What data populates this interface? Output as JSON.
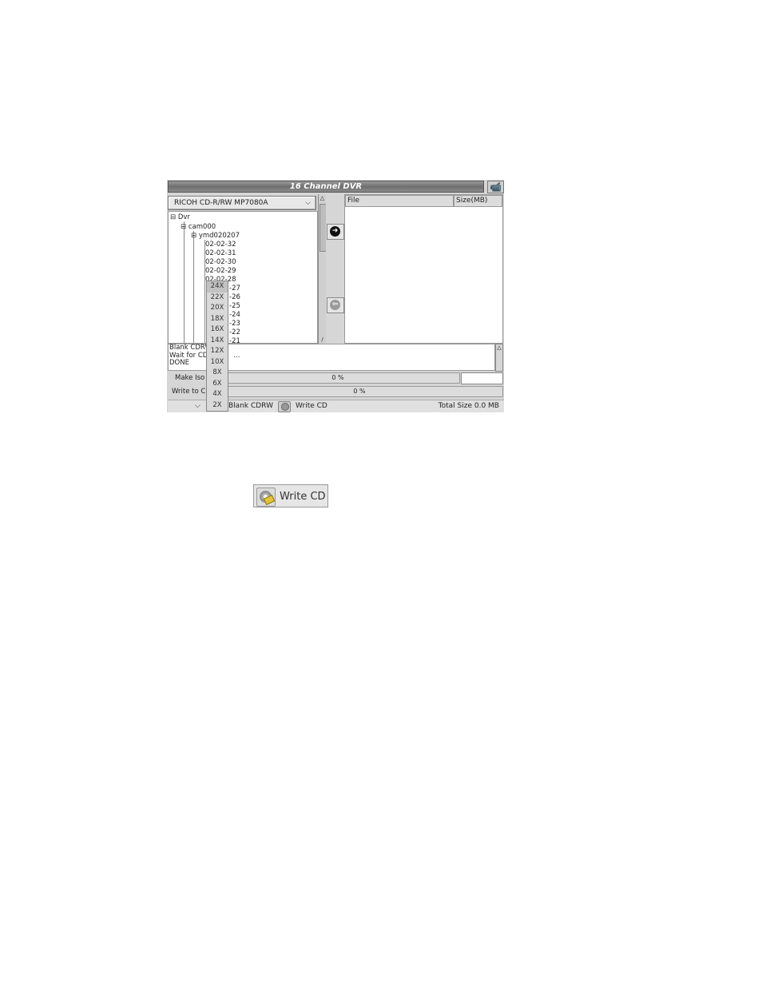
{
  "window": {
    "title": "16 Channel DVR",
    "camera_icon": "camera-icon"
  },
  "drive_selector": {
    "value": "RICOH CD-R/RW MP7080A"
  },
  "tree": {
    "root": "Dvr",
    "camera": "cam000",
    "folder": "ymd020207",
    "items": [
      "02-02-32",
      "02-02-31",
      "02-02-30",
      "02-02-29",
      "02-02-28",
      "-27",
      "-26",
      "-25",
      "-24",
      "-23",
      "-22",
      "-21"
    ]
  },
  "file_list": {
    "col_file": "File",
    "col_size": "Size(MB)"
  },
  "log": {
    "lines": [
      "Blank CDRW",
      "Wait for CD",
      "DONE"
    ],
    "line2_tail": "..."
  },
  "progress": {
    "make_iso_label": "Make Iso",
    "make_iso_value": "0 %",
    "make_iso_percent": 0,
    "write_label": "Write to CD",
    "write_value": "0 %",
    "write_percent": 0
  },
  "bottom": {
    "blank_label": "Blank CDRW",
    "write_label": "Write CD",
    "total_size": "Total Size 0.0 MB"
  },
  "speed_menu": {
    "options": [
      "24X",
      "22X",
      "20X",
      "18X",
      "16X",
      "14X",
      "12X",
      "10X",
      "8X",
      "6X",
      "4X",
      "2X"
    ],
    "selected": "24X"
  },
  "write_cd_button": {
    "label": "Write CD",
    "icon": "write-cd-icon"
  }
}
